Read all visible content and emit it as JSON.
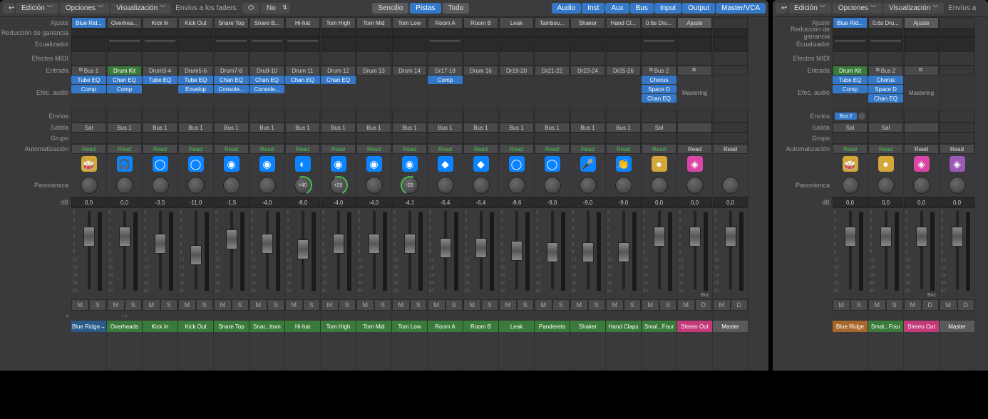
{
  "toolbar": {
    "back_icon": "↩",
    "edicion": "Edición",
    "opciones": "Opciones",
    "visualizacion": "Visualización",
    "envios_label": "Envíos a los faders:",
    "envios_value": "No",
    "sencillo": "Sencillo",
    "pistas": "Pistas",
    "todo": "Todo",
    "audio": "Audio",
    "inst": "Inst",
    "aux": "Aux",
    "bus": "Bus",
    "input": "Input",
    "output": "Output",
    "master": "Master/VCA",
    "envios_a": "Envíos a"
  },
  "labels": {
    "ajuste": "Ajuste",
    "reduccion": "Reducción de ganancia",
    "ecualizador": "Ecualizador",
    "efectos_midi": "Efectos MIDI",
    "entrada": "Entrada",
    "efec_audio": "Efec. audio",
    "envios": "Envíos",
    "salida": "Salida",
    "grupo": "Grupo",
    "automatizacion": "Automatización",
    "panoramica": "Panorámica",
    "db": "dB",
    "mastering": "Mastering"
  },
  "w1_strips": [
    {
      "name": "Blue Ridge→",
      "ajuste": "Blue Rid...",
      "ajusteSel": true,
      "entrada": "Bus 1",
      "entradaLink": true,
      "inserts": [
        "Tube EQ",
        "Comp"
      ],
      "salida": "Sal",
      "auto": "Read",
      "db": "0,0",
      "nameColor": "n-blue",
      "iconColor": "ti-yellow",
      "iconGlyph": "🥁",
      "faderTop": 22
    },
    {
      "name": "Overheads",
      "ajuste": "Overhea...",
      "entrada": "Drum Kit",
      "entradaGreen": true,
      "inserts": [
        "Chan EQ",
        "Comp"
      ],
      "salida": "Bus 1",
      "auto": "Read",
      "db": "0,0",
      "nameColor": "n-green",
      "iconColor": "ti-blue",
      "iconGlyph": "🎧",
      "faderTop": 22,
      "eq": true
    },
    {
      "name": "Kick In",
      "ajuste": "Kick In",
      "entrada": "Drum3-4",
      "inserts": [
        "Tube EQ"
      ],
      "salida": "Bus 1",
      "auto": "Read",
      "db": "-3,5",
      "nameColor": "n-green",
      "iconColor": "ti-blue",
      "iconGlyph": "◯",
      "faderTop": 32,
      "eq": true
    },
    {
      "name": "Kick Out",
      "ajuste": "Kick Out",
      "entrada": "Drum5-6",
      "inserts": [
        "Tube EQ",
        "Envelop"
      ],
      "salida": "Bus 1",
      "auto": "Read",
      "db": "-11,0",
      "nameColor": "n-green",
      "iconColor": "ti-blue",
      "iconGlyph": "◯",
      "faderTop": 48
    },
    {
      "name": "Snare Top",
      "ajuste": "Snare Top",
      "entrada": "Drum7-8",
      "inserts": [
        "Chan EQ",
        "Console..."
      ],
      "salida": "Bus 1",
      "auto": "Read",
      "db": "-1,5",
      "nameColor": "n-green",
      "iconColor": "ti-blue",
      "iconGlyph": "◉",
      "faderTop": 26,
      "eq": true
    },
    {
      "name": "Snar...ttom",
      "ajuste": "Snare B...",
      "entrada": "Dru9-10",
      "inserts": [
        "Chan EQ",
        "Console..."
      ],
      "salida": "Bus 1",
      "auto": "Read",
      "db": "-4,0",
      "nameColor": "n-green",
      "iconColor": "ti-blue",
      "iconGlyph": "◉",
      "faderTop": 32,
      "eq": true
    },
    {
      "name": "Hi-hat",
      "ajuste": "Hi-hat",
      "entrada": "Drum 11",
      "inserts": [
        "Chan EQ"
      ],
      "salida": "Bus 1",
      "auto": "Read",
      "db": "-8,0",
      "nameColor": "n-green",
      "iconColor": "ti-blue",
      "iconGlyph": "◐",
      "faderTop": 40,
      "eq": true,
      "pan": "+40",
      "panGreen": "r"
    },
    {
      "name": "Tom High",
      "ajuste": "Tom High",
      "entrada": "Drum 12",
      "inserts": [
        "Chan EQ"
      ],
      "salida": "Bus 1",
      "auto": "Read",
      "db": "-4,0",
      "nameColor": "n-green",
      "iconColor": "ti-blue",
      "iconGlyph": "◉",
      "faderTop": 32,
      "pan": "+29",
      "panGreen": "r"
    },
    {
      "name": "Tom Mid",
      "ajuste": "Tom Mid",
      "entrada": "Drum 13",
      "inserts": [],
      "salida": "Bus 1",
      "auto": "Read",
      "db": "-4,0",
      "nameColor": "n-green",
      "iconColor": "ti-blue",
      "iconGlyph": "◉",
      "faderTop": 32
    },
    {
      "name": "Tom Low",
      "ajuste": "Tom Low",
      "entrada": "Drum 14",
      "inserts": [],
      "salida": "Bus 1",
      "auto": "Read",
      "db": "-4,1",
      "nameColor": "n-green",
      "iconColor": "ti-blue",
      "iconGlyph": "◉",
      "faderTop": 32,
      "pan": "-23",
      "panGreen": "l"
    },
    {
      "name": "Room A",
      "ajuste": "Room A",
      "entrada": "Dr17-18",
      "inserts": [
        "Comp"
      ],
      "salida": "Bus 1",
      "auto": "Read",
      "db": "-6,4",
      "nameColor": "n-green",
      "iconColor": "ti-blue",
      "iconGlyph": "◆",
      "faderTop": 38,
      "eq": true
    },
    {
      "name": "Room B",
      "ajuste": "Room B",
      "entrada": "Drum 16",
      "inserts": [],
      "salida": "Bus 1",
      "auto": "Read",
      "db": "-6,4",
      "nameColor": "n-green",
      "iconColor": "ti-blue",
      "iconGlyph": "◆",
      "faderTop": 38
    },
    {
      "name": "Leak",
      "ajuste": "Leak",
      "entrada": "Dr19-20",
      "inserts": [],
      "salida": "Bus 1",
      "auto": "Read",
      "db": "-8,6",
      "nameColor": "n-green",
      "iconColor": "ti-blue",
      "iconGlyph": "◯",
      "faderTop": 42
    },
    {
      "name": "Pandereta",
      "ajuste": "Tambou...",
      "entrada": "Dr21-22",
      "inserts": [],
      "salida": "Bus 1",
      "auto": "Read",
      "db": "-9,0",
      "nameColor": "n-green",
      "iconColor": "ti-blue",
      "iconGlyph": "◯",
      "faderTop": 44
    },
    {
      "name": "Shaker",
      "ajuste": "Shaker",
      "entrada": "Dr23-24",
      "inserts": [],
      "salida": "Bus 1",
      "auto": "Read",
      "db": "-9,0",
      "nameColor": "n-green",
      "iconColor": "ti-blue",
      "iconGlyph": "🎤",
      "faderTop": 44
    },
    {
      "name": "Hand Claps",
      "ajuste": "Hand Cl...",
      "entrada": "Dr25-26",
      "inserts": [],
      "salida": "Bus 1",
      "auto": "Read",
      "db": "-9,0",
      "nameColor": "n-green",
      "iconColor": "ti-blue",
      "iconGlyph": "👏",
      "faderTop": 44
    },
    {
      "name": "Smal...Four",
      "ajuste": "0.6s Dru...",
      "entrada": "Bus 2",
      "entradaLink": true,
      "inserts": [
        "Chorus",
        "Space D",
        "Chan EQ"
      ],
      "salida": "Sal",
      "auto": "Read",
      "db": "0,0",
      "nameColor": "n-green",
      "iconColor": "ti-yellow",
      "iconGlyph": "●",
      "faderTop": 22,
      "eq": true
    },
    {
      "name": "Stereo Out",
      "ajuste": "Ajuste",
      "ajusteGray": true,
      "entrada": "",
      "entradaLink": true,
      "inserts": [],
      "mastering": true,
      "salida": "",
      "auto": "Read",
      "autoWhite": true,
      "db": "0,0",
      "nameColor": "n-magenta",
      "iconColor": "ti-magenta",
      "iconGlyph": "◈",
      "faderTop": 22,
      "bnc": "Bnc",
      "msD": true
    },
    {
      "name": "Master",
      "ajuste": "",
      "noAjuste": true,
      "entrada": "",
      "noEntrada": true,
      "inserts": [],
      "salida": "",
      "noSalida": true,
      "auto": "Read",
      "autoWhite": true,
      "db": "0,0",
      "nameColor": "n-gray",
      "noIcon": true,
      "faderTop": 22,
      "msD": true
    }
  ],
  "w2_strips": [
    {
      "name": "Blue Ridge",
      "ajuste": "Blue Rid...",
      "ajusteSel": true,
      "entrada": "Drum Kit",
      "entradaGreen": true,
      "inserts": [
        "Tube EQ",
        "Comp"
      ],
      "sends": "Bus 2",
      "salida": "Sal",
      "auto": "Read",
      "db": "0,0",
      "nameColor": "n-orange",
      "iconColor": "ti-yellow",
      "iconGlyph": "🥁",
      "faderTop": 22,
      "eq": true
    },
    {
      "name": "Smal...Four",
      "ajuste": "0.6s Dru...",
      "entrada": "Bus 2",
      "entradaLink": true,
      "inserts": [
        "Chorus",
        "Space D",
        "Chan EQ"
      ],
      "salida": "Sal",
      "auto": "Read",
      "db": "0,0",
      "nameColor": "n-green",
      "iconColor": "ti-yellow",
      "iconGlyph": "●",
      "faderTop": 22,
      "eq": true
    },
    {
      "name": "Stereo Out",
      "ajuste": "Ajuste",
      "ajusteGray": true,
      "entrada": "",
      "entradaLink": true,
      "inserts": [],
      "mastering": true,
      "salida": "",
      "auto": "Read",
      "autoWhite": true,
      "db": "0,0",
      "nameColor": "n-magenta",
      "iconColor": "ti-magenta",
      "iconGlyph": "◈",
      "faderTop": 22,
      "bnc": "Bnc",
      "msD": true
    },
    {
      "name": "Master",
      "ajuste": "",
      "noAjuste": true,
      "entrada": "",
      "noEntrada": true,
      "inserts": [],
      "salida": "",
      "noSalida": true,
      "auto": "Read",
      "autoWhite": true,
      "db": "0,0",
      "nameColor": "n-gray",
      "iconColor": "ti-purple",
      "iconGlyph": "◈",
      "faderTop": 22,
      "msD": true
    }
  ],
  "fader_scale": [
    "6",
    "3",
    "0",
    "3",
    "6",
    "9",
    "12",
    "18",
    "24",
    "35",
    "50"
  ],
  "ms": {
    "m": "M",
    "s": "S",
    "d": "D"
  },
  "expand": {
    "minus": "−",
    "plus": "+",
    "chev": "›"
  }
}
